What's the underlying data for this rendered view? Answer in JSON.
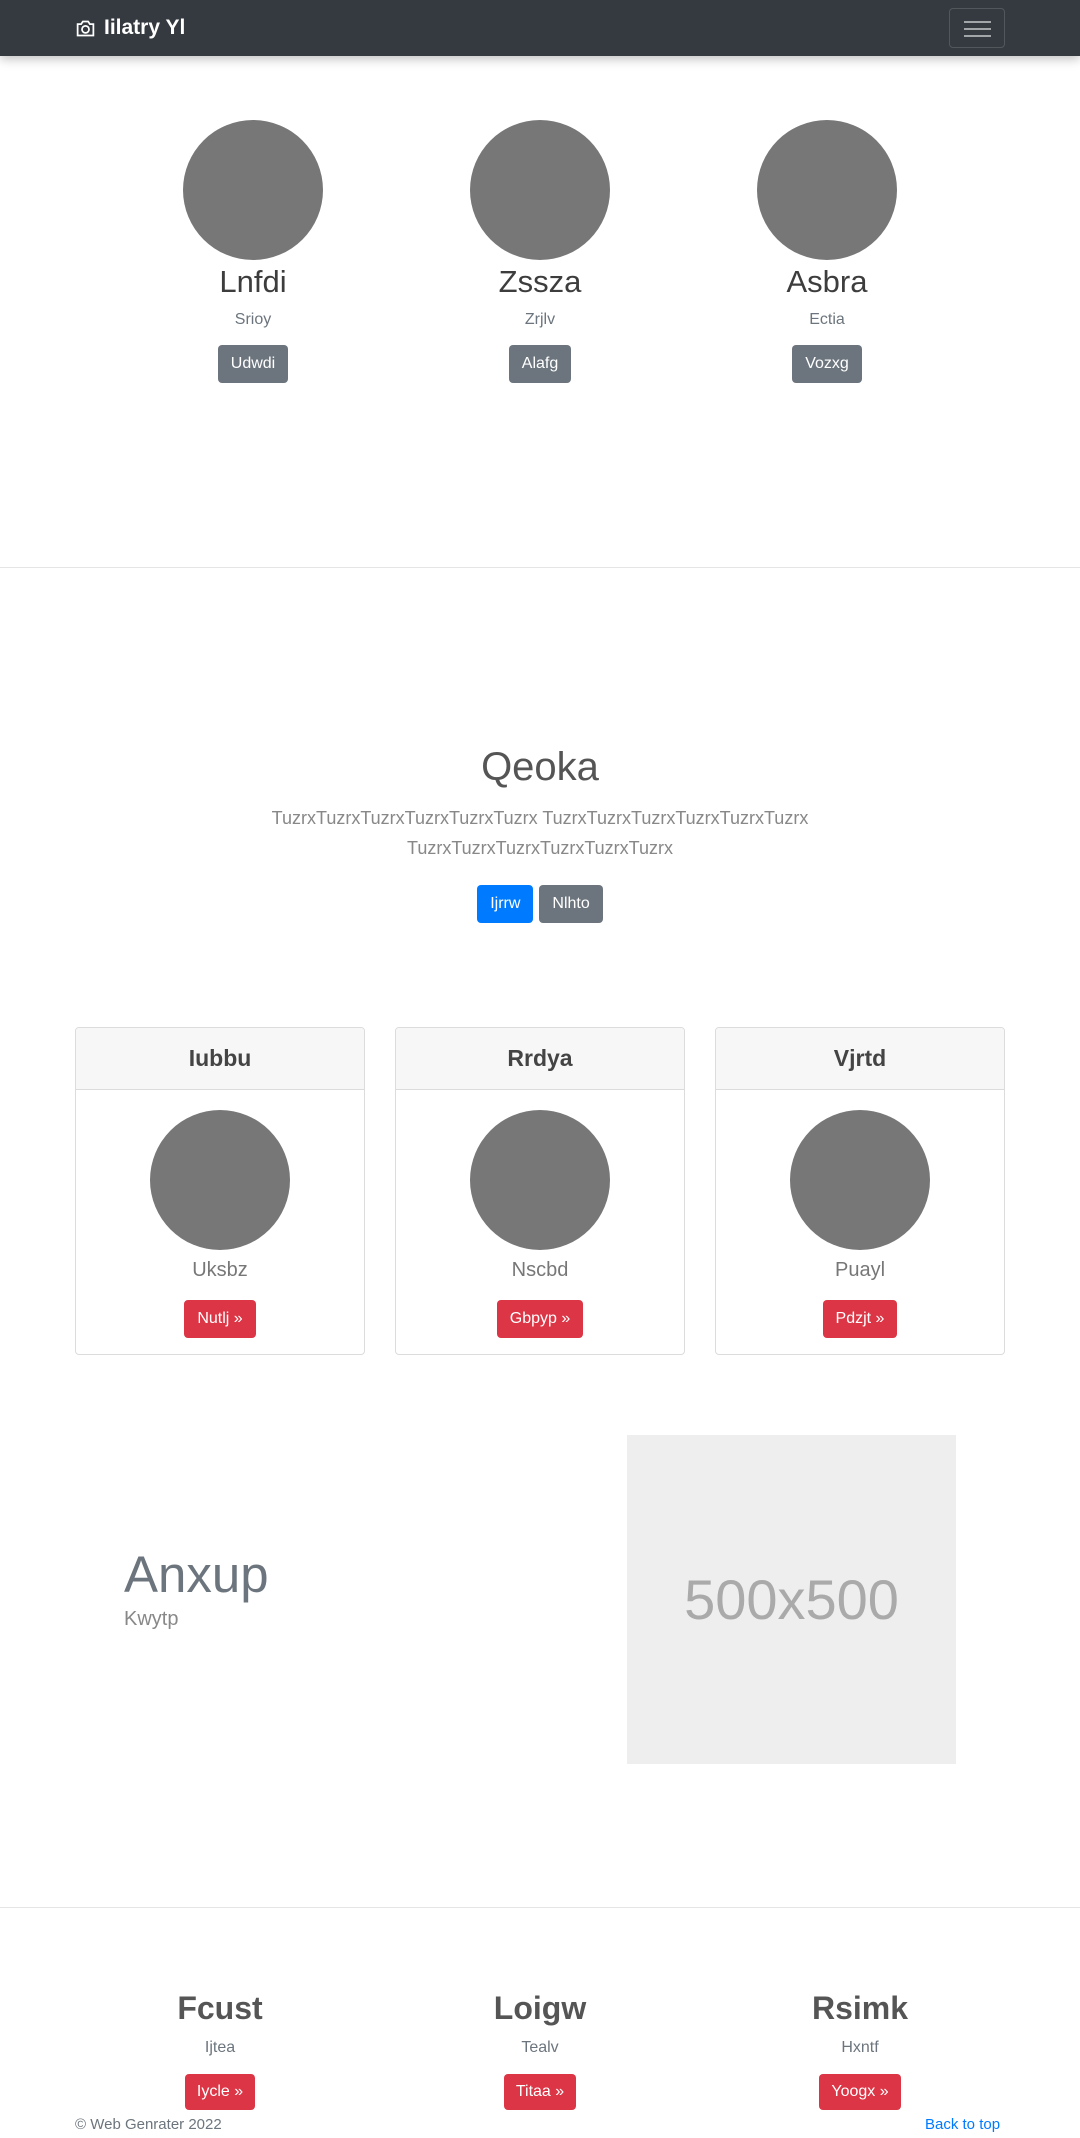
{
  "navbar": {
    "brand": "Iilatry Yl",
    "brand_icon": "camera-icon",
    "menu_icon": "hamburger-icon"
  },
  "team": [
    {
      "name": "Lnfdi",
      "role": "Srioy",
      "button": "Udwdi"
    },
    {
      "name": "Zssza",
      "role": "Zrjlv",
      "button": "Alafg"
    },
    {
      "name": "Asbra",
      "role": "Ectia",
      "button": "Vozxg"
    }
  ],
  "hero": {
    "title": "Qeoka",
    "text": "TuzrxTuzrxTuzrxTuzrxTuzrxTuzrx TuzrxTuzrxTuzrxTuzrxTuzrxTuzrx TuzrxTuzrxTuzrxTuzrxTuzrxTuzrx",
    "primary_button": "Ijrrw",
    "secondary_button": "Nlhto"
  },
  "cards": [
    {
      "title": "Iubbu",
      "text": "Uksbz",
      "button": "Nutlj »"
    },
    {
      "title": "Rrdya",
      "text": "Nscbd",
      "button": "Gbpyp »"
    },
    {
      "title": "Vjrtd",
      "text": "Puayl",
      "button": "Pdzjt »"
    }
  ],
  "feature": {
    "title": "Anxup",
    "subtitle": "Kwytp",
    "image_label": "500x500"
  },
  "footer_columns": [
    {
      "title": "Fcust",
      "text": "Ijtea",
      "button": "Iycle »"
    },
    {
      "title": "Loigw",
      "text": "Tealv",
      "button": "Titaa »"
    },
    {
      "title": "Rsimk",
      "text": "Hxntf",
      "button": "Yoogx »"
    }
  ],
  "footer": {
    "copyright": "© Web Genrater 2022",
    "back_to_top": "Back to top"
  },
  "colors": {
    "navbar": "#343a40",
    "primary": "#007bff",
    "secondary": "#6c757d",
    "danger": "#dc3545",
    "avatar": "#777777"
  }
}
